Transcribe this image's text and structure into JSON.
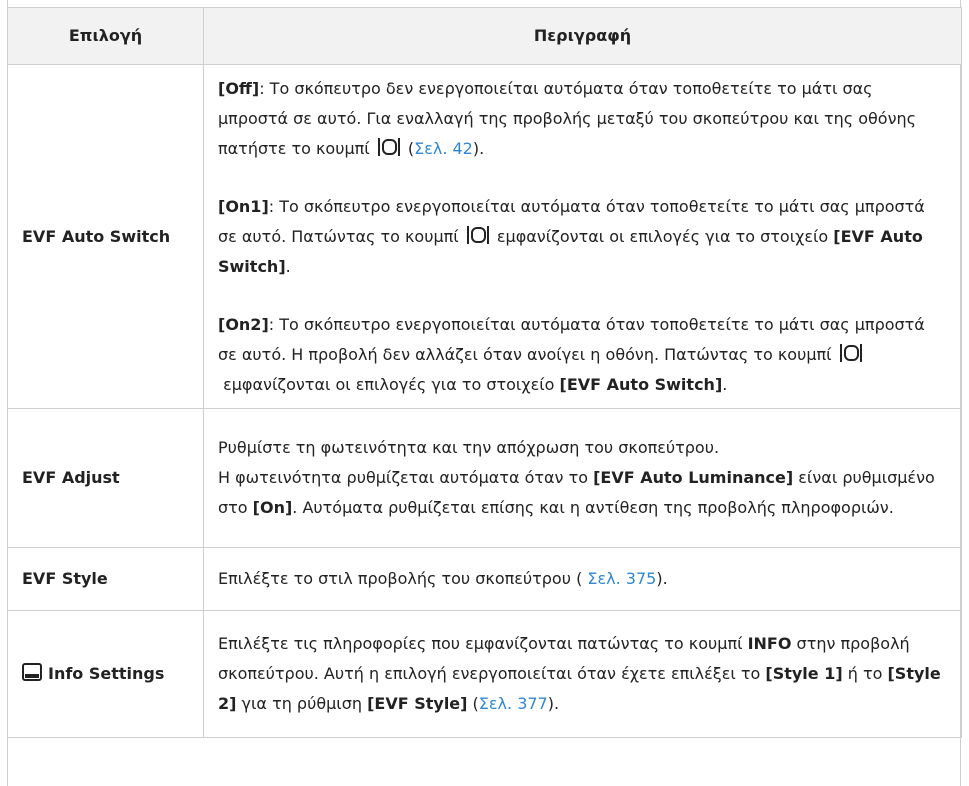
{
  "header": {
    "option": "Επιλογή",
    "description": "Περιγραφή"
  },
  "rows": [
    {
      "option": "EVF Auto Switch",
      "off": {
        "key": "[Off]",
        "text1": ": Το σκόπευτρο δεν ενεργοποιείται αυτόματα όταν τοποθετείτε το μάτι σας μπροστά σε αυτό. Για εναλλαγή της προβολής μεταξύ του σκοπεύτρου και της οθόνης πατήστε το κουμπί",
        "text2": " (",
        "link": "Σελ. 42",
        "text3": ")."
      },
      "on1": {
        "key": "[On1]",
        "text1": ": Το σκόπευτρο ενεργοποιείται αυτόματα όταν τοποθετείτε το μάτι σας μπροστά σε αυτό. Πατώντας το κουμπί",
        "text2": "εμφανίζονται οι επιλογές για το στοιχείο",
        "ref": "[EVF Auto Switch]",
        "text3": "."
      },
      "on2": {
        "key": "[On2]",
        "text1": ": Το σκόπευτρο ενεργοποιείται αυτόματα όταν τοποθετείτε το μάτι σας μπροστά σε αυτό. Η προβολή δεν αλλάζει όταν ανοίγει η οθόνη. Πατώντας το κουμπί",
        "text2": "εμφανίζονται οι επιλογές για το στοιχείο",
        "ref": "[EVF Auto Switch]",
        "text3": "."
      }
    },
    {
      "option": "EVF Adjust",
      "line1": "Ρυθμίστε τη φωτεινότητα και την απόχρωση του σκοπεύτρου.",
      "text1": "Η φωτεινότητα ρυθμίζεται αυτόματα όταν το",
      "ref1": "[EVF Auto Luminance]",
      "text2": "είναι ρυθμισμένο στο",
      "ref2": "[On]",
      "text3": ". Αυτόματα ρυθμίζεται επίσης και η αντίθεση της προβολής πληροφοριών."
    },
    {
      "option": "EVF Style",
      "text1": "Επιλέξτε το στιλ προβολής του σκοπεύτρου (",
      "link": "Σελ. 375",
      "text2": ")."
    },
    {
      "option": "Info Settings",
      "icon": "viewfinder-info-icon",
      "text1": "Επιλέξτε τις πληροφορίες που εμφανίζονται πατώντας το κουμπί",
      "ref1": "INFO",
      "text2": "στην προβολή σκοπεύτρου. Αυτή η επιλογή ενεργοποιείται όταν έχετε επιλέξει το",
      "ref2": "[Style 1]",
      "text3": "ή το",
      "ref3": "[Style 2]",
      "text4": "για τη ρύθμιση",
      "ref4": "[EVF Style]",
      "text5": " (",
      "link": "Σελ. 377",
      "text6": ")."
    }
  ],
  "icons": {
    "display_button": "display-switch-icon"
  },
  "colors": {
    "link": "#2f86d6",
    "header_bg": "#f2f2f2",
    "border": "#cfcfcf"
  }
}
